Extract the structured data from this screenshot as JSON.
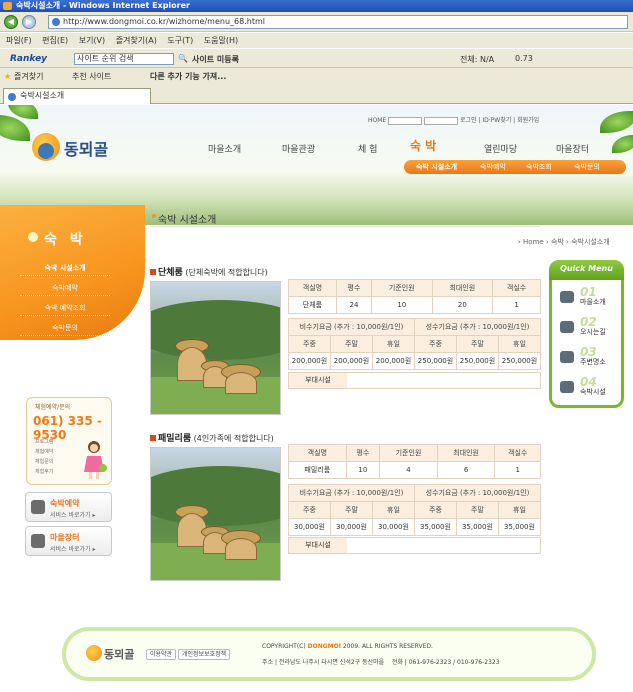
{
  "browser": {
    "title": "숙박시설소개 - Windows Internet Explorer",
    "url": "http://www.dongmoi.co.kr/wizhome/menu_68.html",
    "menu": [
      "파일(F)",
      "편집(E)",
      "보기(V)",
      "즐겨찾기(A)",
      "도구(T)",
      "도움말(H)"
    ],
    "rankey": {
      "logo": "Rankey",
      "search": "사이트 순위 검색",
      "site": "사이트 미등록",
      "total": "전체: N/A",
      "value": "0.73"
    },
    "favorites": {
      "label": "즐겨찾기",
      "recommended": "추천 사이트",
      "more": "다른 추가 기능 가져..."
    },
    "tab": "숙박시설소개"
  },
  "site": {
    "logo": "동뫼골",
    "top_links": {
      "home": "HOME",
      "login": "로그인",
      "idpw": "ID·PW찾기",
      "join": "회원가입"
    },
    "gnb": [
      "마을소개",
      "마을관광",
      "체 험",
      "숙 박",
      "열린마당",
      "마을장터"
    ],
    "subnav": [
      "숙박 시설소개",
      "숙박예약",
      "숙박조회",
      "숙박문의"
    ],
    "lnb": {
      "title": "숙 박",
      "items": [
        "숙박 시설소개",
        "숙박예약",
        "숙박 예약조회",
        "숙박문의"
      ]
    },
    "contact": {
      "header": "체험예약/문의",
      "phone": "061) 335 - 9530",
      "items": [
        "프로그램",
        "체험예약",
        "체험문의",
        "체험후기"
      ]
    },
    "shortcuts": [
      {
        "title": "숙박예약",
        "sub": "서비스 바로가기 ▸"
      },
      {
        "title": "마을장터",
        "sub": "서비스 바로가기 ▸"
      }
    ],
    "page_title": "숙박 시설소개",
    "breadcrumb": "› Home › 숙박 › 숙박시설소개",
    "rooms": [
      {
        "name": "단체룸",
        "desc": "(단체숙박에 적합합니다)",
        "head": [
          "객실명",
          "평수",
          "기준인원",
          "최대인원",
          "객실수"
        ],
        "row": [
          "단체룸",
          "24",
          "10",
          "20",
          "1"
        ],
        "price_head": [
          "비수기요금 (추가 : 10,000원/1인)",
          "성수기요금 (추가 : 10,000원/1인)"
        ],
        "day_head": [
          "주중",
          "주말",
          "휴일",
          "주중",
          "주말",
          "휴일"
        ],
        "prices": [
          "200,000원",
          "200,000원",
          "200,000원",
          "250,000원",
          "250,000원",
          "250,000원"
        ],
        "extra_label": "부대시설"
      },
      {
        "name": "패밀리룸",
        "desc": "(4인가족에 적합합니다)",
        "head": [
          "객실명",
          "평수",
          "기준인원",
          "최대인원",
          "객실수"
        ],
        "row": [
          "패밀리룸",
          "10",
          "4",
          "6",
          "1"
        ],
        "price_head": [
          "비수기요금 (추가 : 10,000원/1인)",
          "성수기요금 (추가 : 10,000원/1인)"
        ],
        "day_head": [
          "주중",
          "주말",
          "휴일",
          "주중",
          "주말",
          "휴일"
        ],
        "prices": [
          "30,000원",
          "30,000원",
          "30,000원",
          "35,000원",
          "35,000원",
          "35,000원"
        ],
        "extra_label": "부대시설"
      }
    ],
    "quick": {
      "title": "Quick Menu",
      "items": [
        {
          "num": "01",
          "label": "마을소개"
        },
        {
          "num": "02",
          "label": "오시는길"
        },
        {
          "num": "03",
          "label": "주변명소"
        },
        {
          "num": "04",
          "label": "숙박시설"
        }
      ]
    },
    "footer": {
      "logo": "동뫼골",
      "links": [
        "이용약관",
        "개인정보보호정책"
      ],
      "copyright_pre": "COPYRIGHT(C) ",
      "copyright_brand": "DONGMOI",
      "copyright_post": " 2009. ALL RIGHTS RESERVED.",
      "address": "주소 | 전라남도 나주시 다시면 신석2구 동산마을",
      "phone": "전화 | 061-976-2323 / 010-976-2323"
    }
  }
}
